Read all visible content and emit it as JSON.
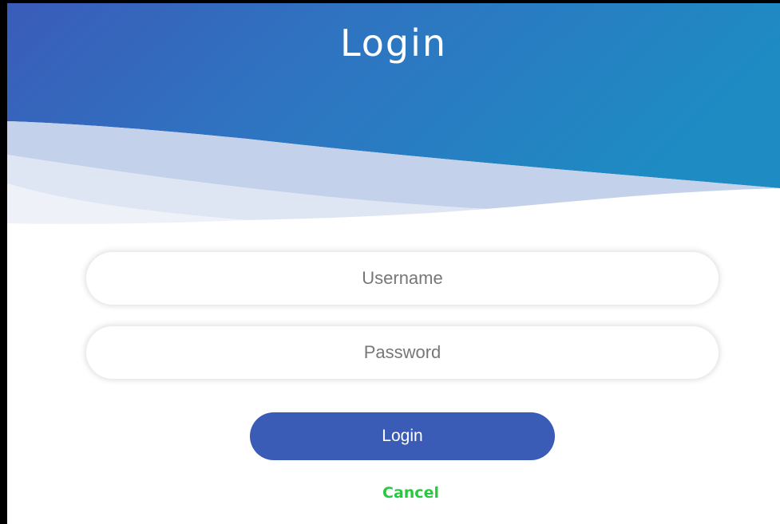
{
  "header": {
    "title": "Login"
  },
  "form": {
    "username_placeholder": "Username",
    "username_value": "",
    "password_placeholder": "Password",
    "password_value": "",
    "login_label": "Login",
    "cancel_label": "Cancel"
  },
  "colors": {
    "header_gradient_start": "#3a5cb9",
    "header_gradient_end": "#1e8bc3",
    "login_button": "#3a5cb7",
    "cancel_link": "#27c93f"
  }
}
